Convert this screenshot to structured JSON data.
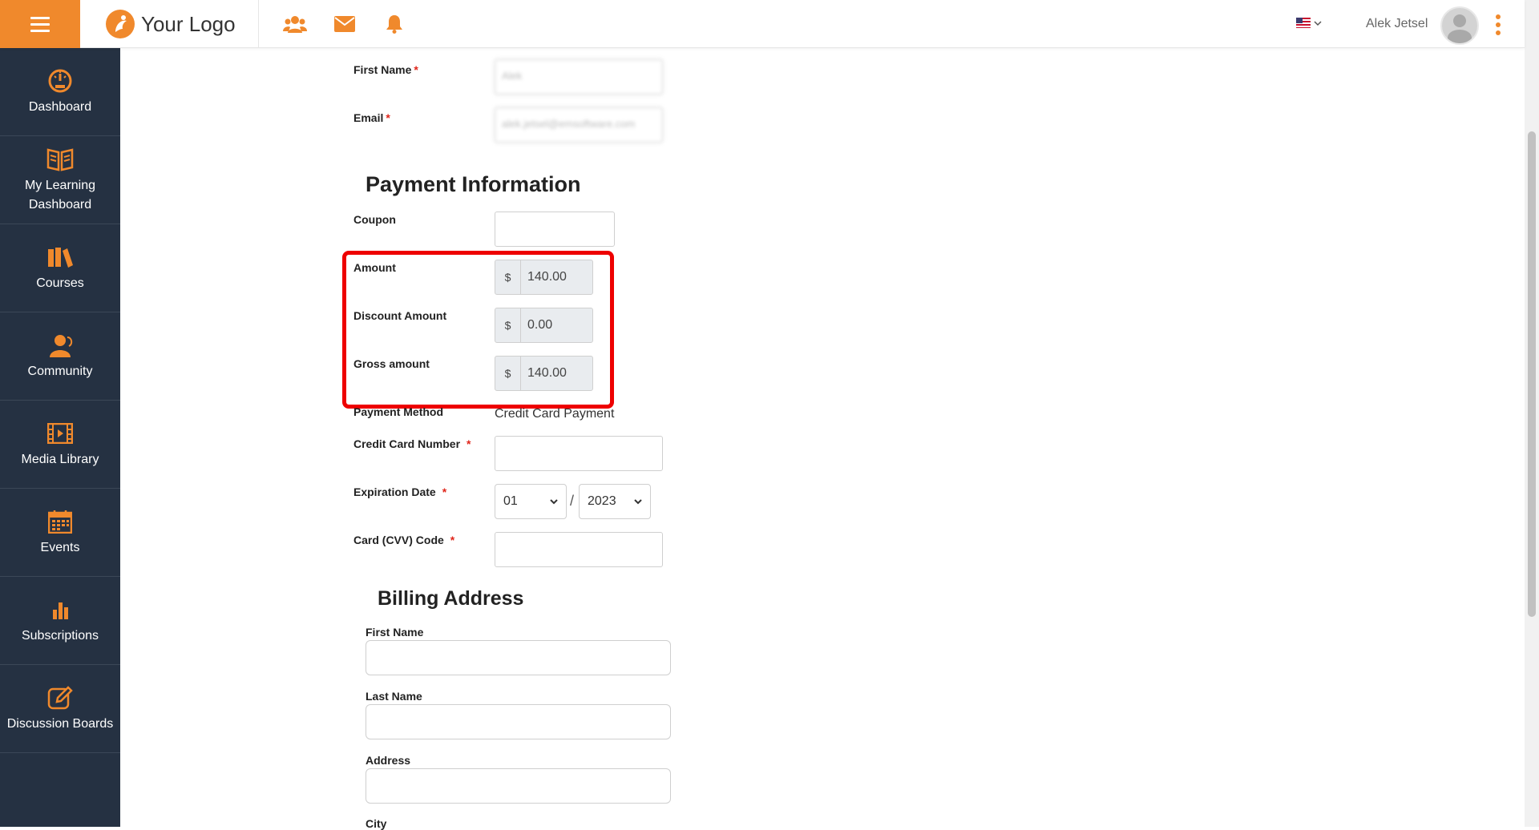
{
  "header": {
    "logo_text": "Your Logo",
    "user_name": "Alek Jetsel",
    "accent_color": "#f0892c"
  },
  "sidebar": {
    "items": [
      {
        "label": "Dashboard",
        "icon": "dashboard-gauge-icon"
      },
      {
        "label": "My Learning Dashboard",
        "icon": "open-book-icon"
      },
      {
        "label": "Courses",
        "icon": "books-icon"
      },
      {
        "label": "Community",
        "icon": "users-icon"
      },
      {
        "label": "Media Library",
        "icon": "film-icon"
      },
      {
        "label": "Events",
        "icon": "calendar-icon"
      },
      {
        "label": "Subscriptions",
        "icon": "bar-chart-icon"
      },
      {
        "label": "Discussion Boards",
        "icon": "edit-icon"
      }
    ]
  },
  "form": {
    "first_name_label": "First Name",
    "email_label": "Email",
    "first_name_value": "Alek",
    "email_value": "alek.jetsel@emsoftware.com",
    "payment_title": "Payment Information",
    "coupon_label": "Coupon",
    "amount_label": "Amount",
    "amount_currency": "$",
    "amount_value": "140.00",
    "discount_label": "Discount Amount",
    "discount_currency": "$",
    "discount_value": "0.00",
    "gross_label": "Gross amount",
    "gross_currency": "$",
    "gross_value": "140.00",
    "payment_method_label": "Payment Method",
    "payment_method_value": "Credit Card Payment",
    "cc_number_label": "Credit Card Number",
    "expiration_label": "Expiration Date",
    "exp_month": "01",
    "exp_slash": "/",
    "exp_year": "2023",
    "cvv_label": "Card (CVV) Code",
    "billing_title": "Billing Address",
    "billing_first_name_label": "First Name",
    "billing_last_name_label": "Last Name",
    "billing_address_label": "Address",
    "billing_city_label": "City",
    "required_mark": "*"
  }
}
